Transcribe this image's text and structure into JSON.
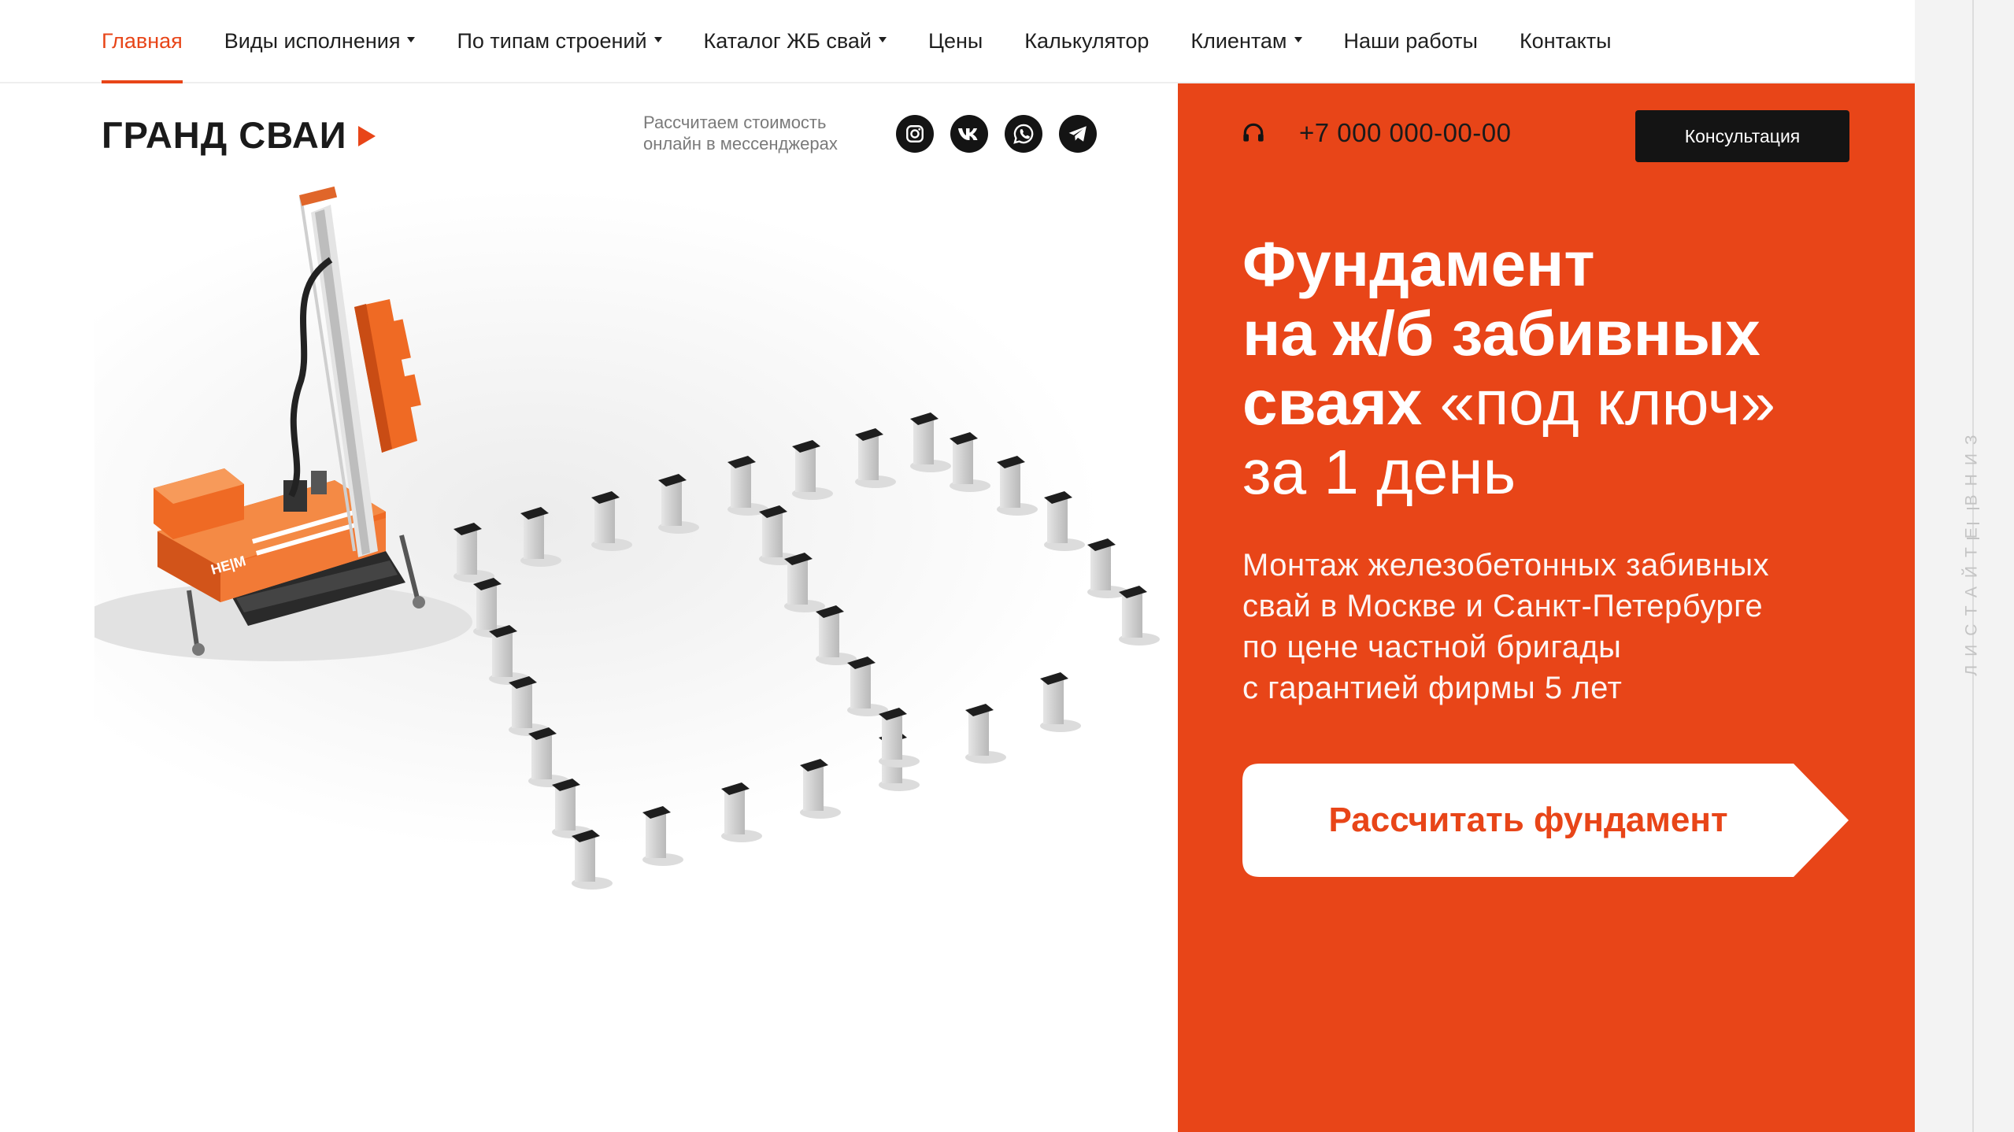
{
  "nav": {
    "items": [
      {
        "label": "Главная",
        "active": true,
        "dropdown": false
      },
      {
        "label": "Виды исполнения",
        "active": false,
        "dropdown": true
      },
      {
        "label": "По типам строений",
        "active": false,
        "dropdown": true
      },
      {
        "label": "Каталог ЖБ свай",
        "active": false,
        "dropdown": true
      },
      {
        "label": "Цены",
        "active": false,
        "dropdown": false
      },
      {
        "label": "Калькулятор",
        "active": false,
        "dropdown": false
      },
      {
        "label": "Клиентам",
        "active": false,
        "dropdown": true
      },
      {
        "label": "Наши работы",
        "active": false,
        "dropdown": false
      },
      {
        "label": "Контакты",
        "active": false,
        "dropdown": false
      }
    ]
  },
  "brand": {
    "name": "ГРАНД СВАИ",
    "accent": "#e84518"
  },
  "messengers": {
    "note_line1": "Рассчитаем стоимость",
    "note_line2": "онлайн в мессенджерах",
    "icons": [
      "instagram-icon",
      "vk-icon",
      "whatsapp-icon",
      "telegram-icon"
    ]
  },
  "contact": {
    "phone": "+7 000 000-00-00",
    "consult_label": "Консультация"
  },
  "hero": {
    "title_bold_1": "Фундамент",
    "title_bold_2": "на ж/б забивных",
    "title_bold_3": "сваях",
    "title_light_3": "«под ключ»",
    "title_light_4": "за 1 день",
    "sub_1": "Монтаж железобетонных забивных",
    "sub_2": "свай в Москве и Санкт-Петербурге",
    "sub_3": "по цене частной бригады",
    "sub_4": "с гарантией фирмы 5 лет",
    "cta_label": "Рассчитать фундамент"
  },
  "rig": {
    "brand_mark": "HE|M"
  },
  "sidebar": {
    "scroll_hint": "ЛИСТАЙТЕ ВНИЗ"
  },
  "colors": {
    "orange": "#e84518",
    "dark": "#141414",
    "white": "#ffffff"
  }
}
